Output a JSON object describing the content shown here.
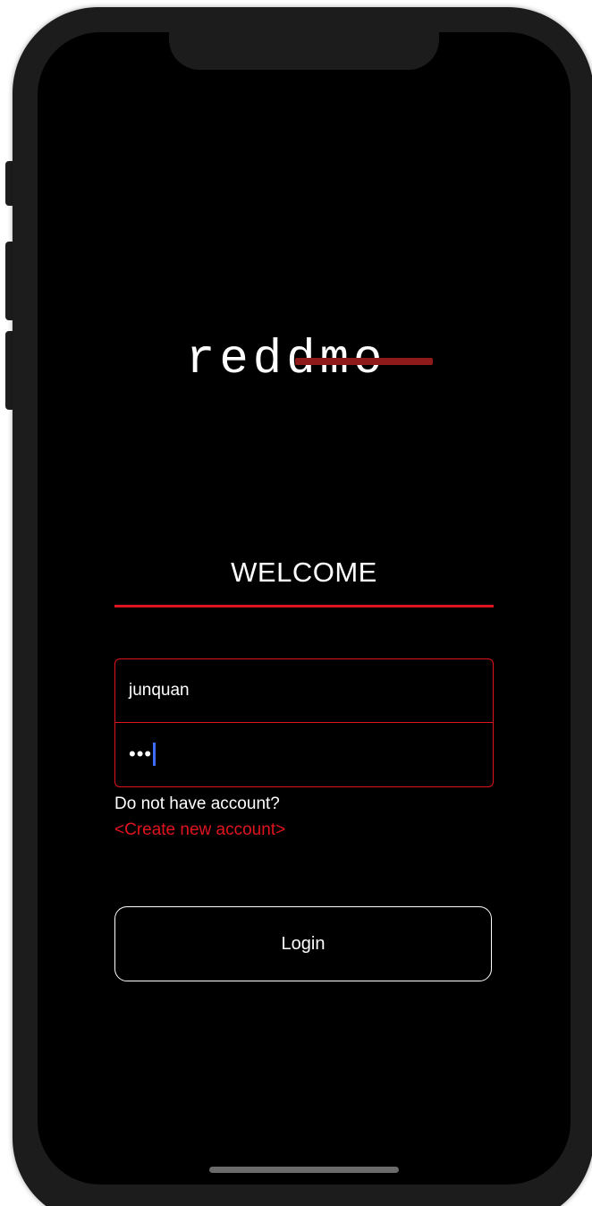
{
  "app": {
    "logo_text": "reddmo"
  },
  "login": {
    "welcome": "WELCOME",
    "username_value": "junquan",
    "password_mask": "•••",
    "no_account_text": "Do not have account?",
    "create_account_link": "<Create new account>",
    "login_label": "Login"
  },
  "colors": {
    "accent": "#e0141e",
    "background": "#000000",
    "logo_strike": "#8f1a1a",
    "caret": "#3d6cff"
  }
}
